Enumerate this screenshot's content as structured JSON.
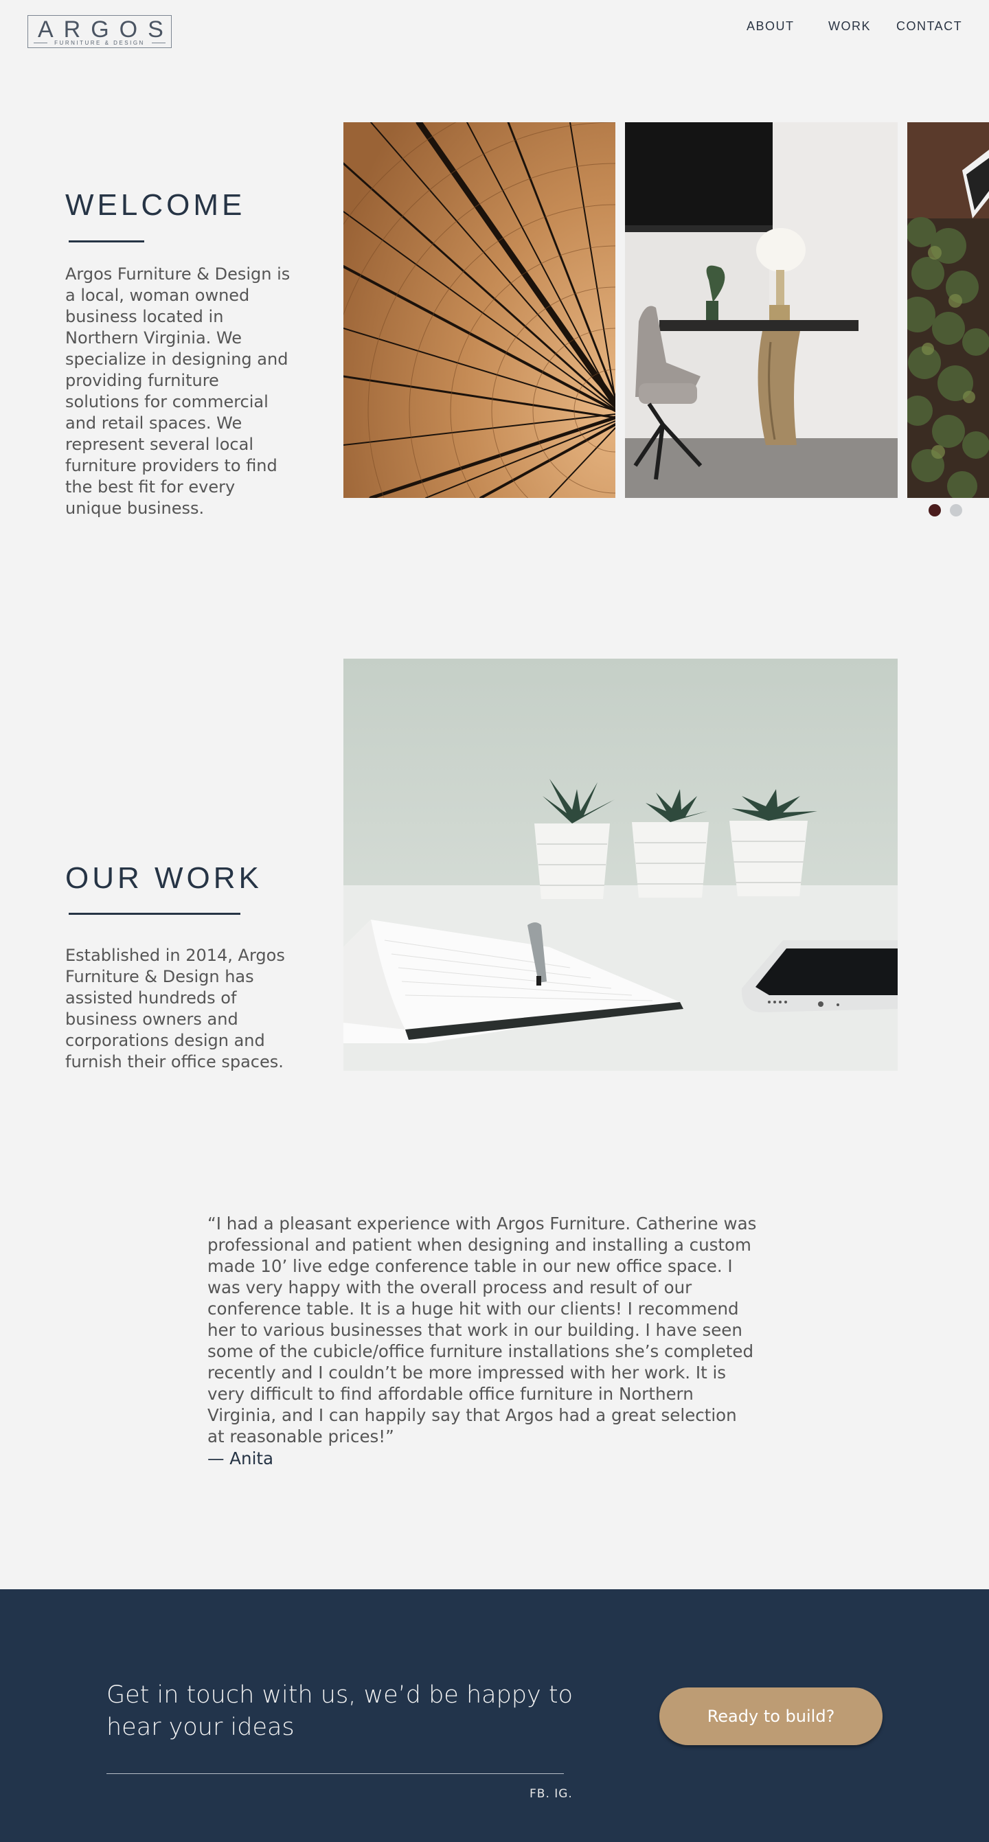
{
  "header": {
    "logo_word": "ARGOS",
    "logo_sub": "FURNITURE & DESIGN",
    "nav": [
      "ABOUT",
      "WORK",
      "CONTACT"
    ]
  },
  "welcome": {
    "title": "WELCOME",
    "body": "Argos Furniture & Design is a local, woman owned business located in Northern Virginia. We specialize in designing and providing furniture solutions for commercial and retail spaces. We represent several local furniture providers to find the best fit for every unique business.",
    "slider": {
      "slides": 2,
      "active_index": 0
    }
  },
  "work": {
    "title": "OUR WORK",
    "body": "Established in 2014, Argos Furniture & Design has assisted hundreds of business owners and corporations design and furnish their office spaces."
  },
  "testimonial": {
    "quote": "“I had a pleasant experience with Argos Furniture. Catherine was professional and patient when designing and installing a custom made 10’ live edge conference table in our new office space. I was very happy with the overall process and result of our conference table. It is a huge hit with our clients! I recommend her to various businesses that work in our building. I have seen some of the cubicle/office furniture installations she’s completed recently and I couldn’t be more impressed with her work. It is very difficult to find affordable office furniture in Northern Virginia, and I can happily say that Argos had a great selection at reasonable prices!”",
    "author": "— Anita"
  },
  "footer": {
    "heading": "Get in touch with us, we’d be happy to hear your ideas",
    "social": "FB. IG.",
    "cta": "Ready to build?"
  },
  "colors": {
    "navy": "#22344b",
    "tan": "#bd9c74",
    "background": "#f3f3f3",
    "dot_active": "#4a1c1c",
    "dot_inactive": "#c9cccf"
  }
}
